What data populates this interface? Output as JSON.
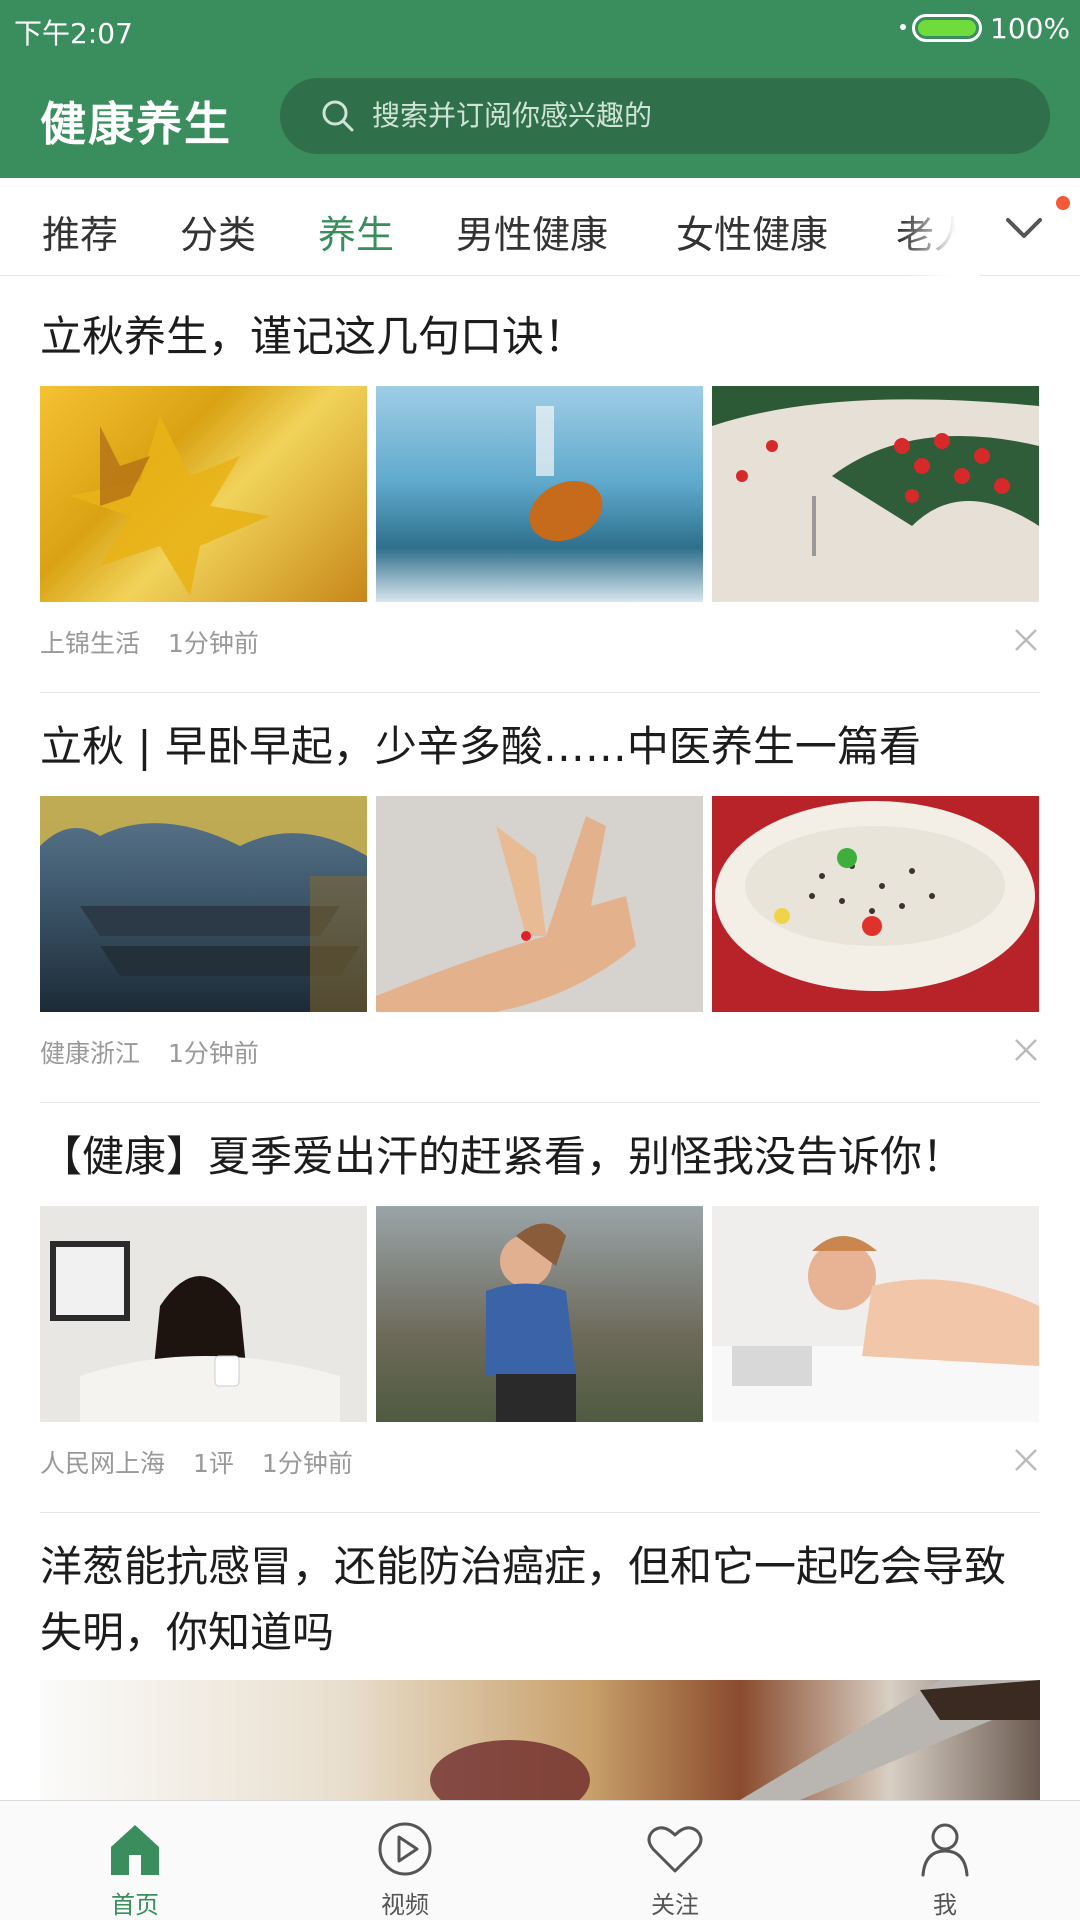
{
  "status": {
    "time": "下午2:07",
    "battery": "100%"
  },
  "header": {
    "title": "健康养生",
    "search_placeholder": "搜索并订阅你感兴趣的"
  },
  "tabs": [
    {
      "label": "推荐",
      "active": false
    },
    {
      "label": "分类",
      "active": false
    },
    {
      "label": "养生",
      "active": true
    },
    {
      "label": "男性健康",
      "active": false
    },
    {
      "label": "女性健康",
      "active": false
    },
    {
      "label": "老人",
      "active": false
    }
  ],
  "articles": [
    {
      "title": "立秋养生，谨记这几句口诀！",
      "source": "上锦生活",
      "comments": "",
      "time": "1分钟前",
      "images": [
        "yellow maple leaves",
        "fallen leaf on frosted grass",
        "red berries with green leaves, 立秋"
      ]
    },
    {
      "title": "立秋 | 早卧早起，少辛多酸……中医养生一篇看",
      "source": "健康浙江",
      "comments": "",
      "time": "1分钟前",
      "images": [
        "misty roofs with autumn leaves, 立秋",
        "hand pressing wrist acupoint",
        "bowl of sesame porridge"
      ]
    },
    {
      "title": "【健康】夏季爱出汗的赶紧看，别怪我没告诉你！",
      "source": "人民网上海",
      "comments": "1评",
      "time": "1分钟前",
      "images": [
        "woman holding a cup",
        "woman running",
        "woman lying on bed"
      ]
    },
    {
      "title": "洋葱能抗感冒，还能防治癌症，但和它一起吃会导致失明，你知道吗",
      "source": "",
      "comments": "",
      "time": "",
      "images": [
        "food with knife"
      ]
    }
  ],
  "bottom_nav": [
    {
      "label": "首页",
      "icon": "home-icon",
      "active": true
    },
    {
      "label": "视频",
      "icon": "video-play-icon",
      "active": false
    },
    {
      "label": "关注",
      "icon": "heart-icon",
      "active": false
    },
    {
      "label": "我",
      "icon": "user-icon",
      "active": false
    }
  ],
  "colors": {
    "brand": "#3a8d5c",
    "search_bg": "#2f6f49",
    "badge": "#f45a37"
  }
}
